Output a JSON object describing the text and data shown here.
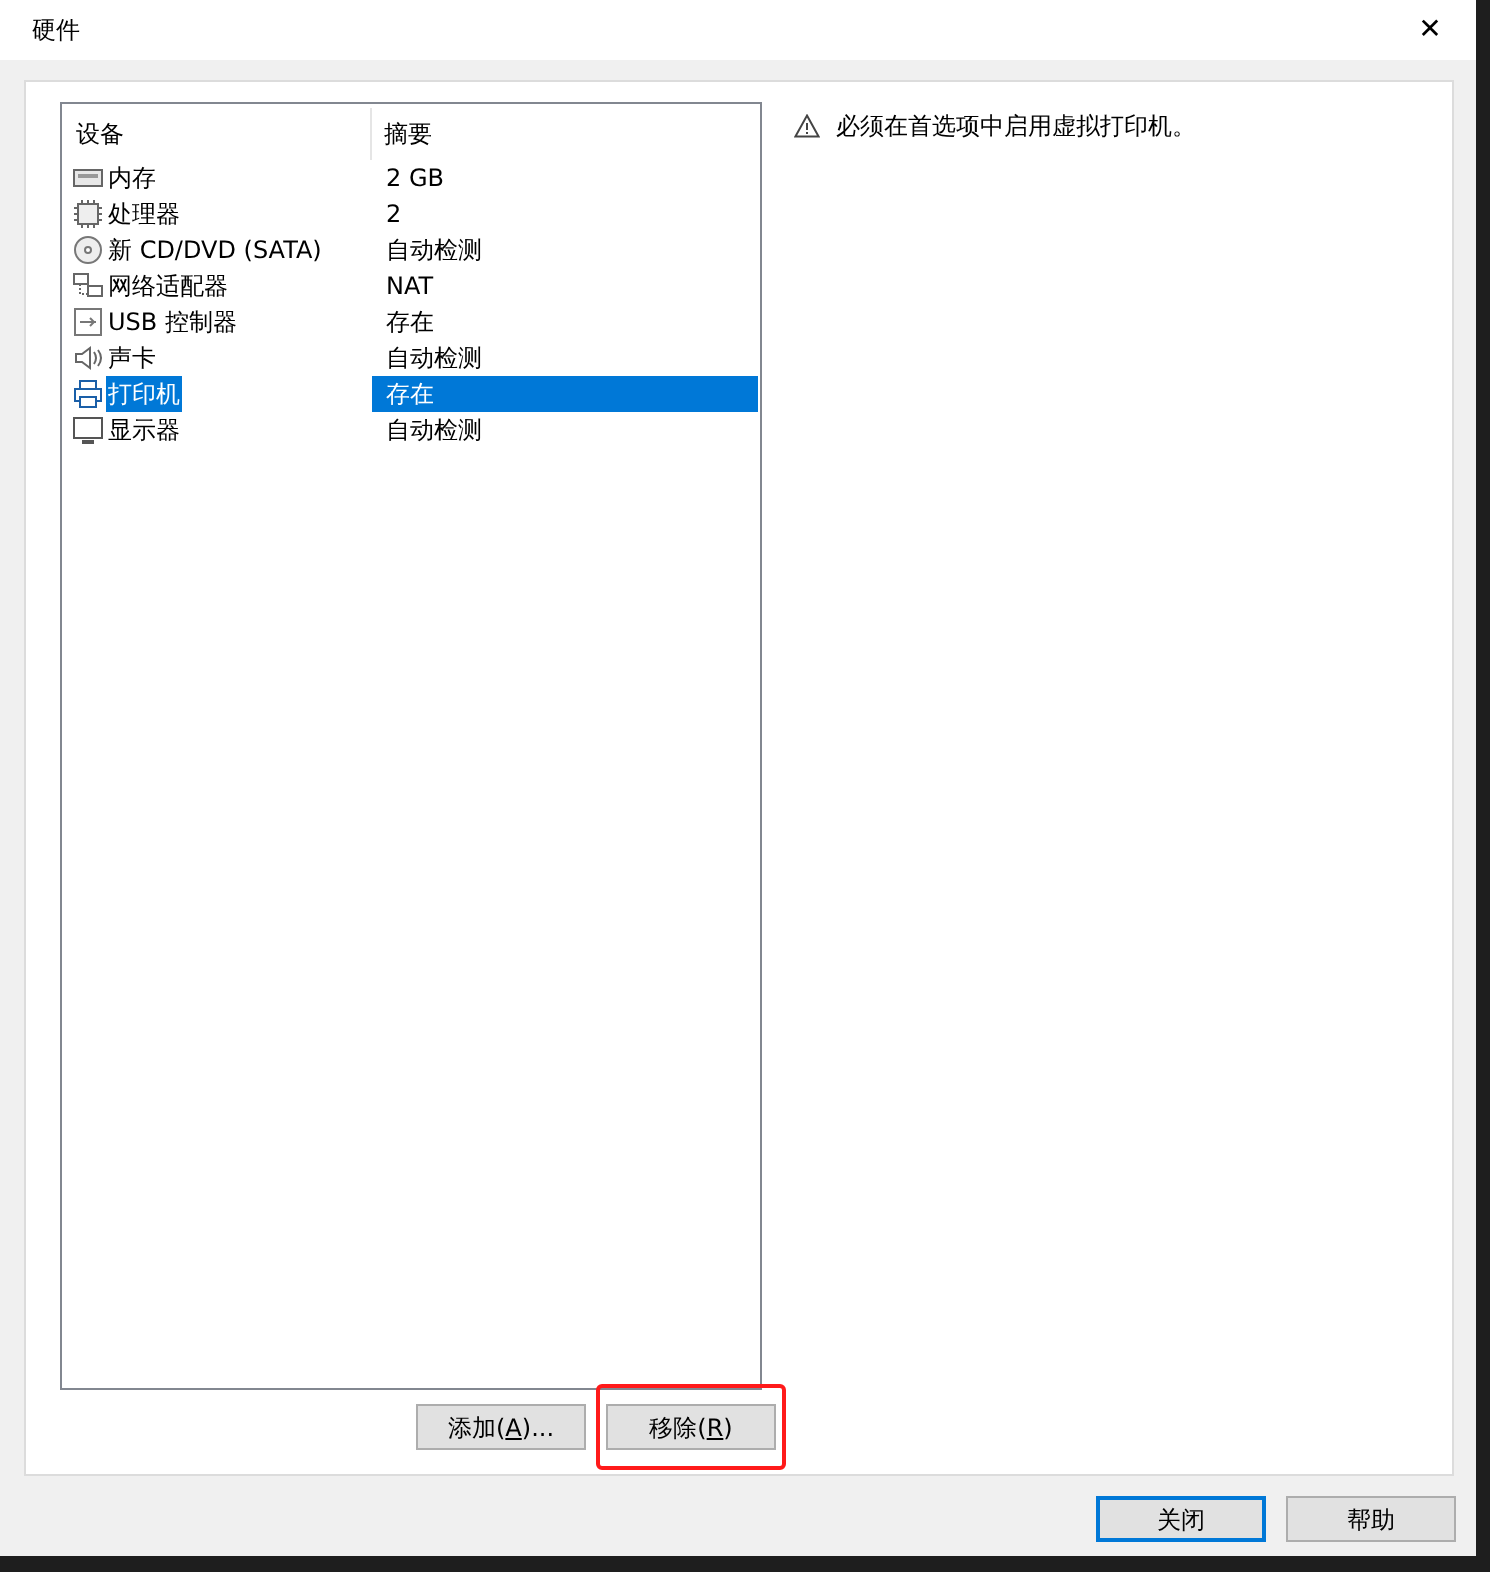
{
  "window": {
    "title": "硬件",
    "close": "✕"
  },
  "devices": {
    "columns": [
      "设备",
      "摘要"
    ],
    "rows": [
      {
        "kind": "memory",
        "device": "内存",
        "summary": "2 GB",
        "selected": false
      },
      {
        "kind": "cpu",
        "device": "处理器",
        "summary": "2",
        "selected": false
      },
      {
        "kind": "disc",
        "device": "新 CD/DVD (SATA)",
        "summary": "自动检测",
        "selected": false
      },
      {
        "kind": "network",
        "device": "网络适配器",
        "summary": "NAT",
        "selected": false
      },
      {
        "kind": "usb",
        "device": "USB 控制器",
        "summary": "存在",
        "selected": false
      },
      {
        "kind": "sound",
        "device": "声卡",
        "summary": "自动检测",
        "selected": false
      },
      {
        "kind": "printer",
        "device": "打印机",
        "summary": "存在",
        "selected": true
      },
      {
        "kind": "monitor",
        "device": "显示器",
        "summary": "自动检测",
        "selected": false
      }
    ]
  },
  "list_buttons": [
    {
      "before": "添加(",
      "key": "A",
      "after": ")...",
      "highlighted": false
    },
    {
      "before": "移除(",
      "key": "R",
      "after": ")",
      "highlighted": true
    }
  ],
  "message": {
    "text": "必须在首选项中启用虚拟打印机。"
  },
  "footer_buttons": [
    {
      "label": "关闭",
      "default": true
    },
    {
      "label": "帮助",
      "default": false
    }
  ]
}
